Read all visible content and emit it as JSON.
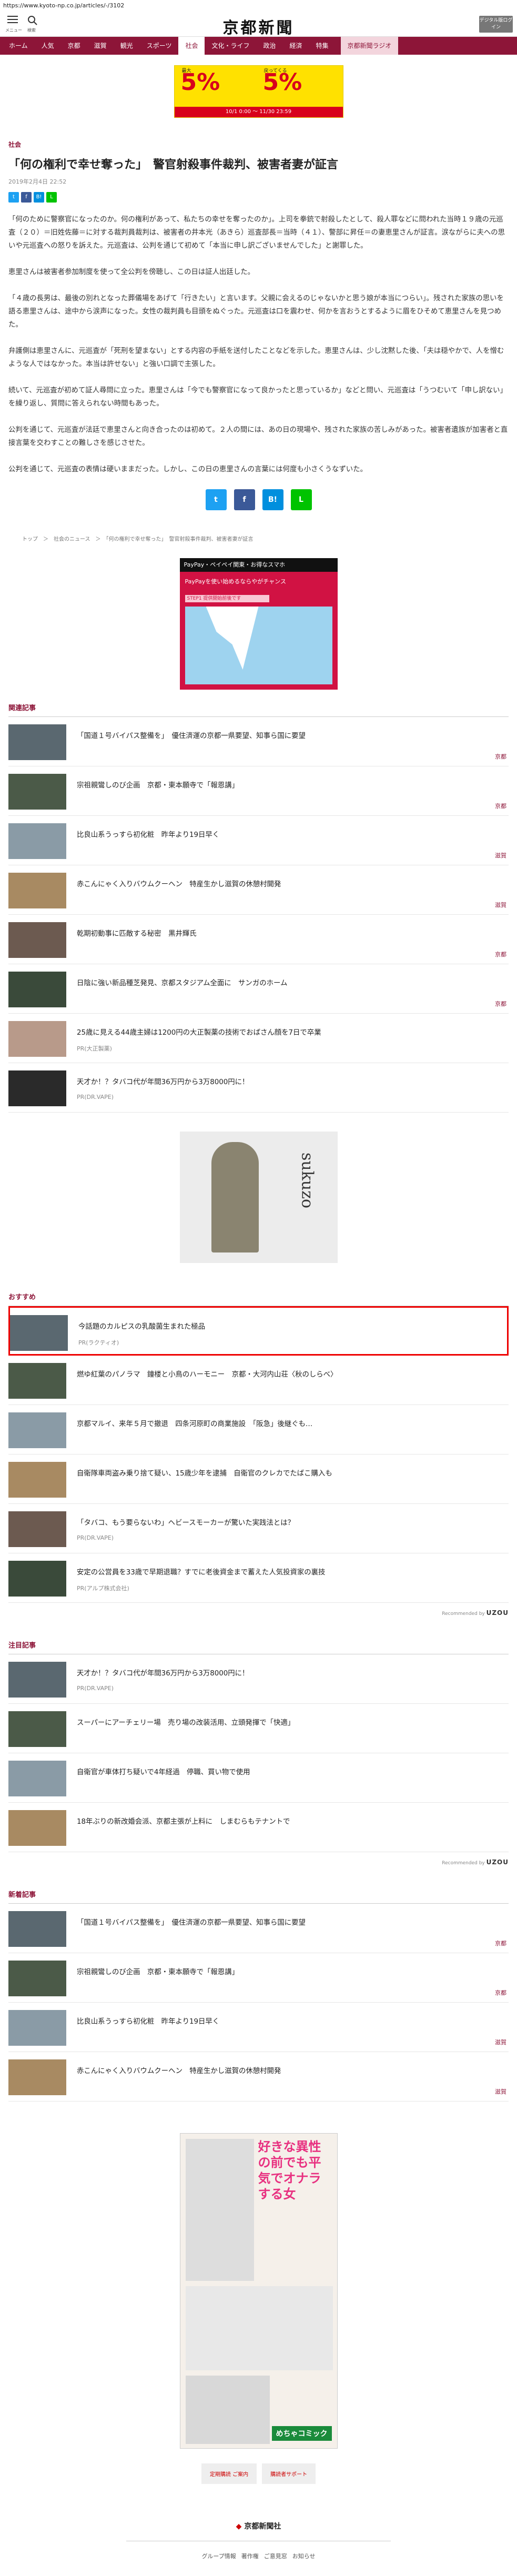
{
  "url": "https://www.kyoto-np.co.jp/articles/-/3102",
  "header": {
    "menu_label": "メニュー",
    "search_label": "検索",
    "logo": "京都新聞",
    "digital_button": "デジタル版ログイン"
  },
  "nav": [
    "ホーム",
    "人気",
    "京都",
    "滋賀",
    "観光",
    "スポーツ",
    "社会",
    "文化・ライフ",
    "政治",
    "経済",
    "特集",
    "京都新聞ラジオ"
  ],
  "nav_active_index": 6,
  "ad_top": {
    "big_left": "5%",
    "big_right": "5%",
    "label_left": "最大",
    "label_right": "戻ってくる",
    "bar": "10/1 0:00 〜 11/30 23:59"
  },
  "article": {
    "section": "社会",
    "title": "「何の権利で幸せ奪った」　警官射殺事件裁判、被害者妻が証言",
    "date": "2019年2月4日 22:52",
    "paragraphs": [
      "「何のために警察官になったのか。何の権利があって、私たちの幸せを奪ったのか」。上司を拳銃で射殺したとして、殺人罪などに問われた当時１９歳の元巡査（２０）＝旧姓佐藤＝に対する裁判員裁判は、被害者の井本光（あきら）巡査部長＝当時（４１）、警部に昇任＝の妻恵里さんが証言。涙ながらに夫への思いや元巡査への怒りを訴えた。元巡査は、公判を通じて初めて「本当に申し訳ございませんでした」と謝罪した。",
      "恵里さんは被害者参加制度を使って全公判を傍聴し、この日は証人出廷した。",
      "「４歳の長男は、最後の別れとなった葬儀場をあげて「行きたい」と言います。父親に会えるのじゃないかと思う娘が本当につらい」。残された家族の思いを語る恵里さんは、途中から涙声になった。女性の裁判員も目頭をぬぐった。元巡査は口を震わせ、何かを言おうとするように眉をひそめて恵里さんを見つめた。",
      "弁護側は恵里さんに、元巡査が「死刑を望まない」とする内容の手紙を送付したことなどを示した。恵里さんは、少し沈黙した後、「夫は穏やかで、人を憎むような人ではなかった。本当は許せない」と強い口調で主張した。",
      "続いて、元巡査が初めて証人尋問に立った。恵里さんは「今でも警察官になって良かったと思っているか」などと問い、元巡査は「うつむいて「申し訳ない」を繰り返し、質問に答えられない時間もあった。",
      "公判を通じて、元巡査が法廷で恵里さんと向き合ったのは初めて。２人の間には、あの日の現場や、残された家族の苦しみがあった。被害者遺族が加害者と直接言葉を交わすことの難しさを感じさせた。",
      "公判を通じて、元巡査の表情は硬いままだった。しかし、この日の恵里さんの言葉には何度も小さくうなずいた。"
    ]
  },
  "share_small": [
    "t",
    "f",
    "B!",
    "L"
  ],
  "share_big": [
    "t",
    "f",
    "B!",
    "L"
  ],
  "breadcrumb": "トップ　＞　社会のニュース　＞　「何の権利で幸せ奪った」　警官射殺事件裁判、被害者妻が証言",
  "ad_mid": {
    "header": "PayPay・ペイペイ関東・お得なスマホ",
    "line2": "PayPayを使い始めるならやがチャンス",
    "step": "STEP1 提供開始前後です"
  },
  "related": {
    "heading": "関連記事",
    "items": [
      {
        "title": "「国道１号バイパス整備を」　優住済運の京都一県要望、知事ら国に要望",
        "cat": "京都",
        "pr": ""
      },
      {
        "title": "宗祖親鸞しのび企画　京都・東本願寺で「報恩講」",
        "cat": "京都",
        "pr": ""
      },
      {
        "title": "比良山系うっすら初化粧　昨年より19日早く",
        "cat": "滋賀",
        "pr": ""
      },
      {
        "title": "赤こんにゃく入りバウムクーヘン　特産生かし滋賀の休憩村開発",
        "cat": "滋賀",
        "pr": ""
      },
      {
        "title": "乾期初動事に匹敵する秘密　黒井輝氏",
        "cat": "京都",
        "pr": ""
      },
      {
        "title": "日陰に強い新品種芝発見、京都スタジアム全面に　サンガのホーム",
        "cat": "京都",
        "pr": ""
      },
      {
        "title": "25歳に見える44歳主婦は1200円の大正製薬の技術でおばさん顔を7日で卒業",
        "cat": "",
        "pr": "PR(大正製薬)"
      },
      {
        "title": "天才か！？タバコ代が年間36万円から3万8000円に！",
        "cat": "",
        "pr": "PR(DR.VAPE)"
      }
    ]
  },
  "ad_sq": {
    "brand": "sukuzo"
  },
  "osusume": {
    "heading": "おすすめ",
    "items": [
      {
        "title": "今話題のカルピスの乳酸菌生まれた極品",
        "pr": "PR(ラクティオ)",
        "cat": ""
      },
      {
        "title": "燃ゆ紅葉のパノラマ　鐘楼と小鳥のハーモニー　京都・大河内山荘〈秋のしらべ〉",
        "pr": "",
        "cat": ""
      },
      {
        "title": "京都マルイ、来年５月で撤退　四条河原町の商業施設　「阪急」後継ぐも…",
        "pr": "",
        "cat": ""
      },
      {
        "title": "自衛隊車両盗み乗り捨て疑い、15歳少年を逮捕　自衛官のクレカでたばこ購入も",
        "pr": "",
        "cat": ""
      },
      {
        "title": "「タバコ、もう要らないわ」ヘビースモーカーが驚いた実践法とは？",
        "pr": "PR(DR.VAPE)",
        "cat": ""
      },
      {
        "title": "安定の公営員を33歳で早期退職？すでに老後資金まで蓄えた人気投資家の裏技",
        "pr": "PR(アルプ株式会社)",
        "cat": ""
      }
    ]
  },
  "recommended_by": "Recommended by",
  "recommended_brand": "UZOU",
  "chumoku": {
    "heading": "注目記事",
    "items": [
      {
        "title": "天才か！？タバコ代が年間36万円から3万8000円に！",
        "pr": "PR(DR.VAPE)"
      },
      {
        "title": "スーパーにアーチェリー場　売り場の改装活用、立頭発揮で「快適」",
        "pr": ""
      },
      {
        "title": "自衛官が車体打ち疑いで4年経過　停職、買い物で使用",
        "pr": ""
      },
      {
        "title": "18年ぶりの新改婚会派、京都主張が上料に　しまむらもテナントで",
        "pr": ""
      }
    ]
  },
  "shinchaku": {
    "heading": "新着記事",
    "items": [
      {
        "title": "「国道１号バイパス整備を」　優住済運の京都一県要望、知事ら国に要望",
        "cat": "京都"
      },
      {
        "title": "宗祖親鸞しのび企画　京都・東本願寺で「報恩講」",
        "cat": "京都"
      },
      {
        "title": "比良山系うっすら初化粧　昨年より19日早く",
        "cat": "滋賀"
      },
      {
        "title": "赤こんにゃく入りバウムクーヘン　特産生かし滋賀の休憩村開発",
        "cat": "滋賀"
      }
    ]
  },
  "manga": {
    "title": "好きな異性の前でも平気でオナラする女",
    "brand": "めちゃコミック"
  },
  "footer_links": [
    "定期購読 ご案内",
    "購読者サポート"
  ],
  "footer_logo": "京都新聞社",
  "footer_nav": [
    "グループ情報",
    "著作権",
    "ご意見窓",
    "お知らせ"
  ]
}
